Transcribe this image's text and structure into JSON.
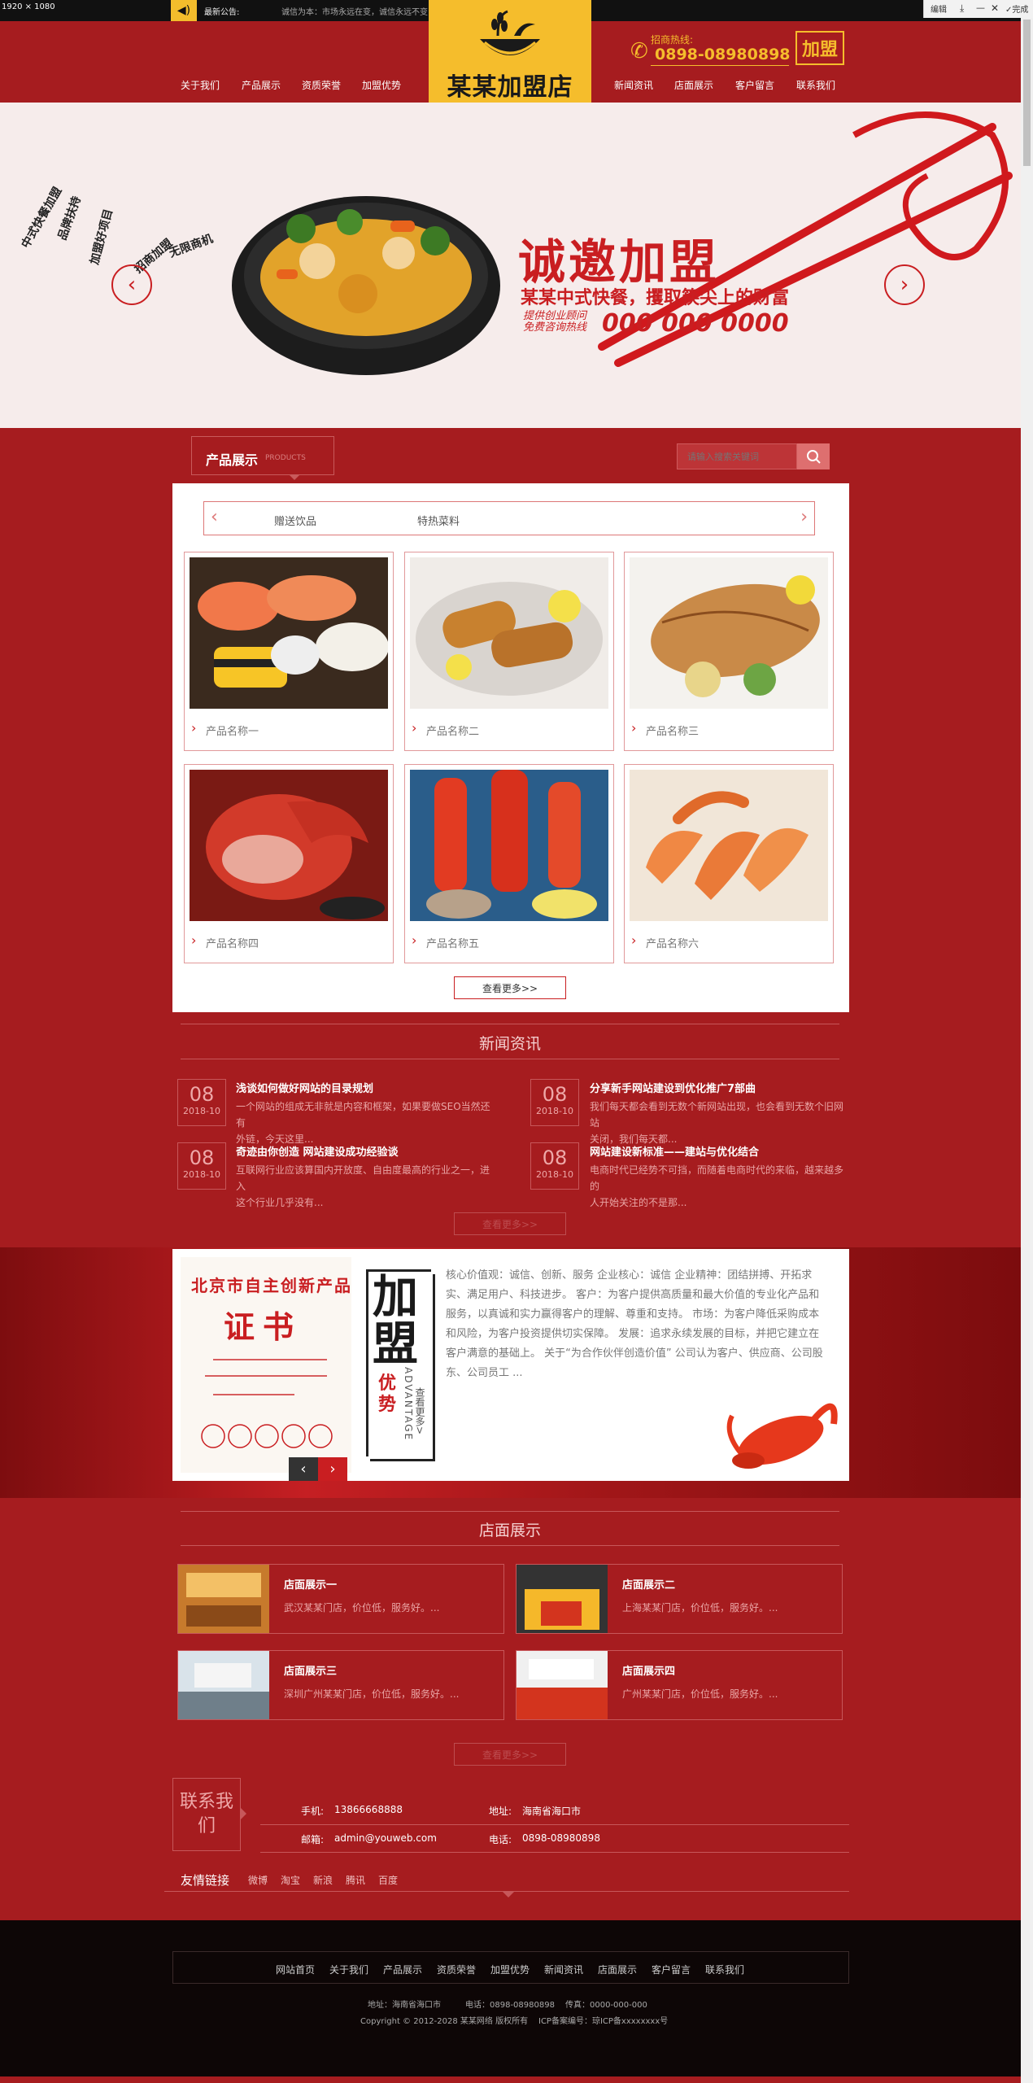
{
  "topbar": {
    "dimensions": "1920 × 1080",
    "notice_label": "最新公告:",
    "notice_text": "诚信为本：市场永远在变，诚信永远不变",
    "toolbar": [
      "编辑",
      "完成"
    ]
  },
  "header": {
    "nav_left": [
      "关于我们",
      "产品展示",
      "资质荣誉",
      "加盟优势"
    ],
    "nav_right": [
      "新闻资讯",
      "店面展示",
      "客户留言",
      "联系我们"
    ],
    "logo_text": "某某加盟店",
    "hotline_label": "招商热线:",
    "hotline_number": "0898-08980898",
    "join_badge": "加盟"
  },
  "banner": {
    "title": "诚邀加盟",
    "subtitle": "某某中式快餐，攫取筷尖上的财富",
    "hotline_label_1": "提供创业顾问",
    "hotline_label_2": "免费咨询热线",
    "phone": "000 000 0000",
    "prev": "‹",
    "next": "›"
  },
  "products": {
    "section_title": "产品展示",
    "section_sub": "PRODUCTS",
    "search_placeholder": "请输入搜索关键词",
    "categories": [
      "赠送饮品",
      "特热菜料"
    ],
    "items": [
      {
        "name": "产品名称一"
      },
      {
        "name": "产品名称二"
      },
      {
        "name": "产品名称三"
      },
      {
        "name": "产品名称四"
      },
      {
        "name": "产品名称五"
      },
      {
        "name": "产品名称六"
      }
    ],
    "more": "查看更多>>"
  },
  "news": {
    "title": "新闻资讯",
    "items": [
      {
        "day": "08",
        "month": "2018-10",
        "title": "浅谈如何做好网站的目录规划",
        "desc_1": "一个网站的组成无非就是内容和框架，如果要做SEO当然还有",
        "desc_2": "外链，今天这里..."
      },
      {
        "day": "08",
        "month": "2018-10",
        "title": "分享新手网站建设到优化推广7部曲",
        "desc_1": "我们每天都会看到无数个新网站出现，也会看到无数个旧网站",
        "desc_2": "关闭，我们每天都..."
      },
      {
        "day": "08",
        "month": "2018-10",
        "title": "奇迹由你创造 网站建设成功经验谈",
        "desc_1": "互联网行业应该算国内开放度、自由度最高的行业之一，进入",
        "desc_2": "这个行业几乎没有..."
      },
      {
        "day": "08",
        "month": "2018-10",
        "title": "网站建设新标准——建站与优化结合",
        "desc_1": "电商时代已经势不可挡，而随着电商时代的来临，越来越多的",
        "desc_2": "人开始关注的不是那..."
      }
    ],
    "more": "查看更多>>"
  },
  "advantage": {
    "cert_title": "北京市自主创新产品",
    "cert_big": "证书",
    "heading": "加盟",
    "heading_2": "优势",
    "heading_en": "ADVANTAGE",
    "link": "查看更多>",
    "text": "核心价值观：诚信、创新、服务 企业核心：诚信 企业精神：团结拼搏、开拓求实、满足用户、科技进步。 客户：为客户提供高质量和最大价值的专业化产品和服务，以真诚和实力赢得客户的理解、尊重和支持。 市场：为客户降低采购成本和风险，为客户投资提供切实保障。 发展：追求永续发展的目标，并把它建立在客户满意的基础上。 关于“为合作伙伴创造价值” 公司认为客户、供应商、公司股东、公司员工 ..."
  },
  "stores": {
    "title": "店面展示",
    "items": [
      {
        "title": "店面展示一",
        "desc": "武汉某某门店，价位低，服务好。..."
      },
      {
        "title": "店面展示二",
        "desc": "上海某某门店，价位低，服务好。..."
      },
      {
        "title": "店面展示三",
        "desc": "深圳广州某某门店，价位低，服务好。..."
      },
      {
        "title": "店面展示四",
        "desc": "广州某某门店，价位低，服务好。..."
      }
    ],
    "more": "查看更多>>"
  },
  "contact": {
    "box": "联系我们",
    "phone_label": "手机:",
    "phone": "13866668888",
    "address_label": "地址:",
    "address": "海南省海口市",
    "email_label": "邮箱:",
    "email": "admin@youweb.com",
    "tel_label": "电话:",
    "tel": "0898-08980898"
  },
  "links": {
    "title": "友情链接",
    "items": [
      "微博",
      "淘宝",
      "新浪",
      "腾讯",
      "百度"
    ]
  },
  "footer": {
    "nav": [
      "网站首页",
      "关于我们",
      "产品展示",
      "资质荣誉",
      "加盟优势",
      "新闻资讯",
      "店面展示",
      "客户留言",
      "联系我们"
    ],
    "address": "地址：海南省海口市",
    "tel": "电话：0898-08980898",
    "fax": "传真：0000-000-000",
    "copyright": "Copyright © 2012-2028 某某网络 版权所有",
    "icp": "ICP备案编号：琼ICP备xxxxxxxx号"
  },
  "colors": {
    "primary_red": "#a61c1f",
    "accent_yellow": "#f5bd2c",
    "footer_bg": "#0d0606"
  }
}
